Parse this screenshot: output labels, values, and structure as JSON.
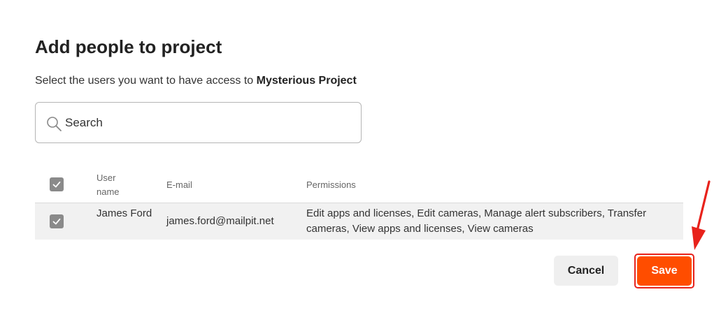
{
  "dialog": {
    "title": "Add people to project",
    "subtitle_prefix": "Select the users you want to have access to",
    "project_name": "Mysterious Project"
  },
  "search": {
    "placeholder": "Search",
    "value": "",
    "icon": "search-icon"
  },
  "table": {
    "columns": {
      "user_name": "User name",
      "email": "E-mail",
      "permissions": "Permissions"
    },
    "select_all_checked": true,
    "rows": [
      {
        "checked": true,
        "user_name": "James Ford",
        "email": "james.ford@mailpit.net",
        "permissions": "Edit apps and licenses, Edit cameras, Manage alert subscribers, Transfer cameras, View apps and licenses, View cameras"
      }
    ]
  },
  "actions": {
    "cancel_label": "Cancel",
    "save_label": "Save"
  },
  "colors": {
    "accent": "#ff4d00",
    "annotation": "#e8221b",
    "checkbox": "#8a8a8a"
  }
}
